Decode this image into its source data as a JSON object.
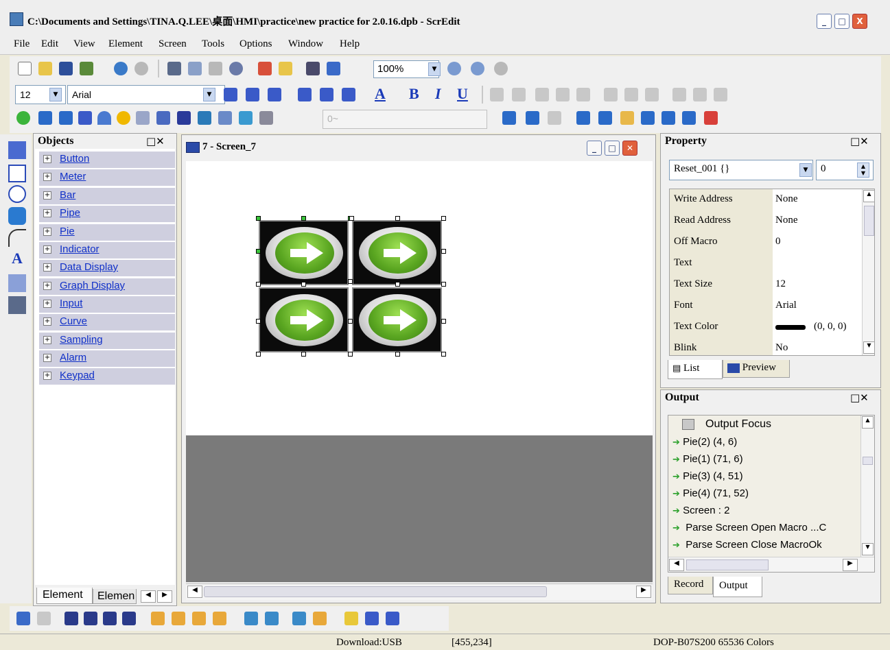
{
  "window": {
    "title": "C:\\Documents and Settings\\TINA.Q.LEE\\桌面\\HMI\\practice\\new practice for 2.0.16.dpb - ScrEdit",
    "minimize": "_",
    "maximize": "□",
    "close": "X"
  },
  "menu": [
    "File",
    "Edit",
    "View",
    "Element",
    "Screen",
    "Tools",
    "Options",
    "Window",
    "Help"
  ],
  "toolbar": {
    "zoom_value": "100%",
    "font_size": "12",
    "font_name": "Arial",
    "bold": "B",
    "italic": "I",
    "underline": "U",
    "a_color": "A",
    "disabled_field": "0~"
  },
  "objects_panel": {
    "title": "Objects",
    "items": [
      "Button",
      "Meter",
      "Bar",
      "Pipe",
      "Pie",
      "Indicator",
      "Data Display",
      "Graph Display",
      "Input",
      "Curve",
      "Sampling",
      "Alarm",
      "Keypad"
    ],
    "tabs": [
      "Element",
      "Elemen"
    ]
  },
  "screen_window": {
    "title": "7 - Screen_7"
  },
  "property_panel": {
    "title": "Property",
    "selector_value": "Reset_001 {}",
    "spin_value": "0",
    "rows": [
      {
        "key": "Write Address",
        "value": "None"
      },
      {
        "key": "Read Address",
        "value": "None"
      },
      {
        "key": "Off Macro",
        "value": "0"
      },
      {
        "key": "Text",
        "value": ""
      },
      {
        "key": "Text Size",
        "value": "12"
      },
      {
        "key": "Font",
        "value": "Arial"
      },
      {
        "key": "Text Color",
        "value": "(0, 0, 0)"
      },
      {
        "key": "Blink",
        "value": "No"
      }
    ],
    "tabs": [
      "List",
      "Preview"
    ]
  },
  "output_panel": {
    "title": "Output",
    "header": "Output Focus",
    "lines": [
      "Pie(2) (4, 6)",
      "Pie(1) (71, 6)",
      "Pie(3) (4, 51)",
      "Pie(4) (71, 52)",
      "Screen : 2",
      "Parse Screen Open Macro ...C",
      "Parse Screen Close MacroOk"
    ],
    "tabs": [
      "Record",
      "Output"
    ]
  },
  "status": {
    "download": "Download:USB",
    "coords": "[455,234]",
    "model": "DOP-B07S200 65536 Colors"
  },
  "colors": {
    "accent_blue": "#1030c8",
    "arrow_green": "#2aa02a",
    "handle_green": "#3bc43b"
  }
}
